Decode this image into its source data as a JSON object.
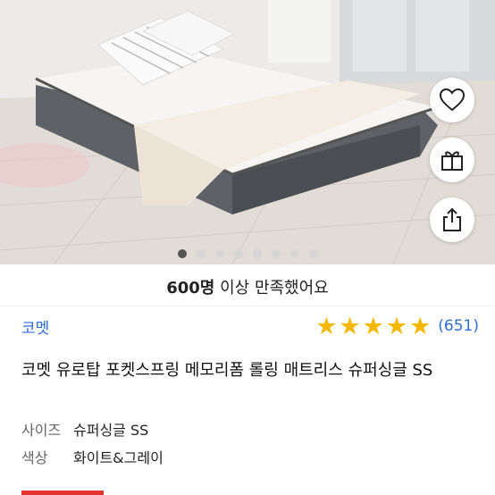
{
  "product_image": {
    "alt": "mattress photo",
    "dots_total": 8,
    "dots_active_index": 0
  },
  "actions": {
    "like_icon": "heart-icon",
    "gift_icon": "gift-icon",
    "share_icon": "share-icon"
  },
  "banner": {
    "count_text": "600명",
    "rest_text": " 이상 만족했어요"
  },
  "brand": {
    "name": "코멧"
  },
  "rating": {
    "stars": 5,
    "count_text": "(651)"
  },
  "product": {
    "title": "코멧 유로탑 포켓스프링 메모리폼 롤링 매트리스 슈퍼싱글 SS"
  },
  "options": [
    {
      "key": "사이즈",
      "value": "슈퍼싱글 SS"
    },
    {
      "key": "색상",
      "value": "화이트&그레이"
    }
  ],
  "colors": {
    "brand_blue": "#2f6dd8",
    "star_yellow": "#f5b800",
    "accent_red": "#e3342f"
  }
}
